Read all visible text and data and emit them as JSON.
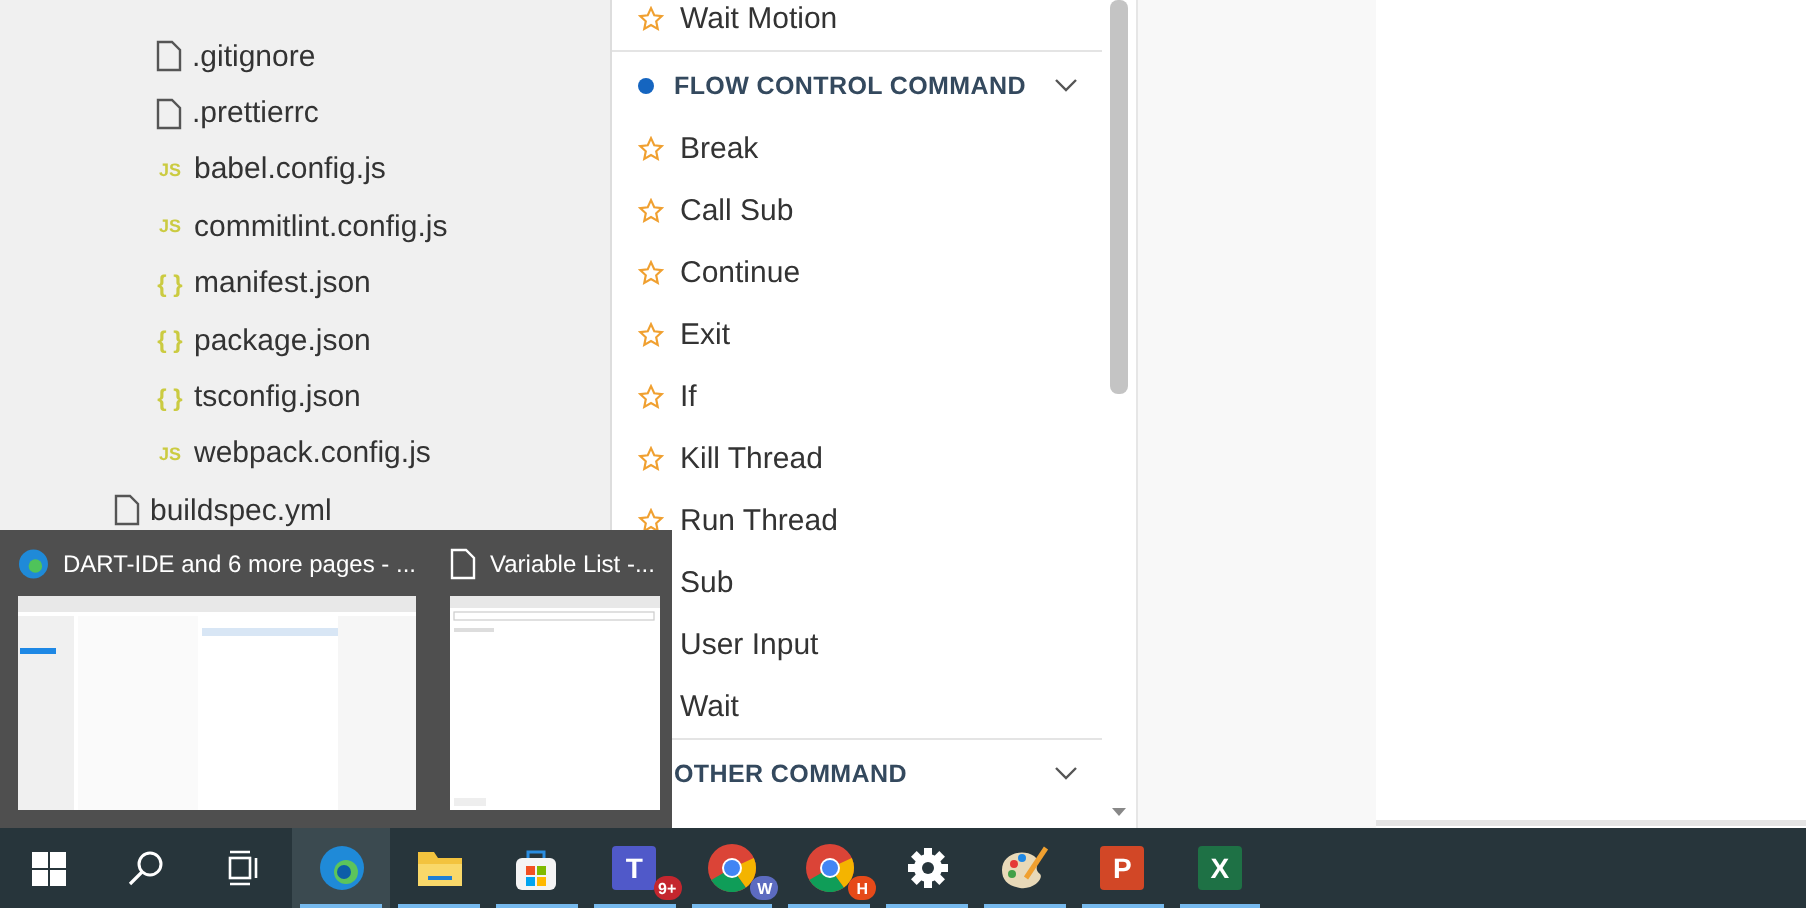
{
  "file_tree": [
    {
      "name": ".gitignore",
      "kind": "file"
    },
    {
      "name": ".prettierrc",
      "kind": "file"
    },
    {
      "name": "babel.config.js",
      "kind": "js",
      "icon_text": "JS"
    },
    {
      "name": "commitlint.config.js",
      "kind": "js",
      "icon_text": "JS"
    },
    {
      "name": "manifest.json",
      "kind": "json",
      "icon_text": "{ }"
    },
    {
      "name": "package.json",
      "kind": "json",
      "icon_text": "{ }"
    },
    {
      "name": "tsconfig.json",
      "kind": "json",
      "icon_text": "{ }"
    },
    {
      "name": "webpack.config.js",
      "kind": "js",
      "icon_text": "JS"
    },
    {
      "name": "buildspec.yml",
      "kind": "file",
      "outer": true
    }
  ],
  "commands": [
    {
      "kind": "item",
      "label": "Wait Motion",
      "starred": true
    },
    {
      "kind": "header",
      "label": "FLOW CONTROL COMMAND",
      "dot": true,
      "expanded": true
    },
    {
      "kind": "item",
      "label": "Break",
      "starred": true
    },
    {
      "kind": "item",
      "label": "Call Sub",
      "starred": true
    },
    {
      "kind": "item",
      "label": "Continue",
      "starred": true
    },
    {
      "kind": "item",
      "label": "Exit",
      "starred": true
    },
    {
      "kind": "item",
      "label": "If",
      "starred": true
    },
    {
      "kind": "item",
      "label": "Kill Thread",
      "starred": true
    },
    {
      "kind": "item",
      "label": "Run Thread",
      "starred": true
    },
    {
      "kind": "item",
      "label": "Sub"
    },
    {
      "kind": "item",
      "label": "User Input"
    },
    {
      "kind": "item",
      "label": "Wait"
    },
    {
      "kind": "header",
      "label": "OTHER COMMAND",
      "expanded": true
    }
  ],
  "task_previews": [
    {
      "title": "DART-IDE and 6 more pages - ...",
      "kind": "browser"
    },
    {
      "title": "Variable List -...",
      "kind": "document"
    }
  ],
  "taskbar": [
    {
      "kind": "windows",
      "selected": false
    },
    {
      "kind": "search",
      "selected": false
    },
    {
      "kind": "taskview",
      "selected": false
    },
    {
      "kind": "edge",
      "running": true,
      "selected": true
    },
    {
      "kind": "folder",
      "running": true,
      "selected": false
    },
    {
      "kind": "store",
      "running": true,
      "selected": false
    },
    {
      "kind": "teams",
      "running": true,
      "selected": false,
      "badge": "9+",
      "letter": "T"
    },
    {
      "kind": "chrome",
      "running": true,
      "selected": false,
      "badge": "W"
    },
    {
      "kind": "chrome",
      "running": true,
      "selected": false,
      "badge": "H"
    },
    {
      "kind": "settings",
      "running": true,
      "selected": false
    },
    {
      "kind": "paint",
      "running": true,
      "selected": false
    },
    {
      "kind": "powerpoint",
      "running": true,
      "selected": false,
      "letter": "P"
    },
    {
      "kind": "excel",
      "running": true,
      "selected": false,
      "letter": "X"
    }
  ]
}
